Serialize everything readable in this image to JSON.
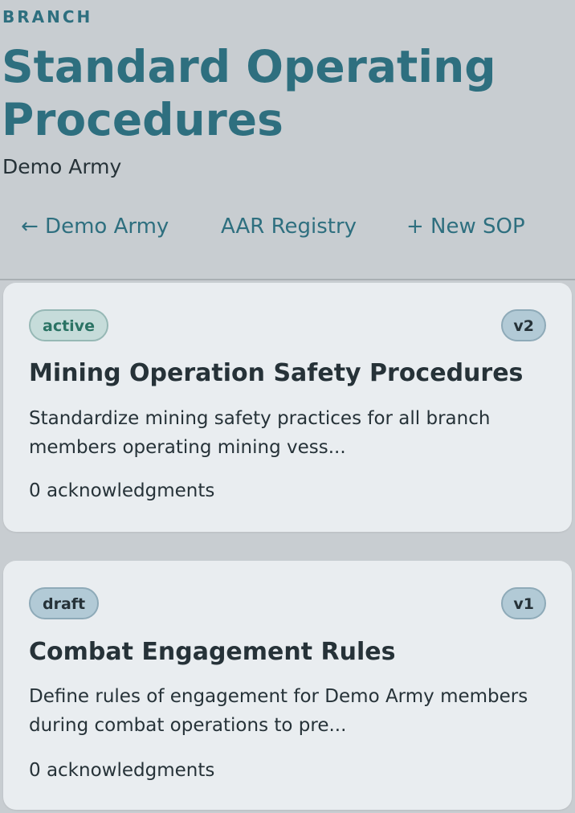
{
  "header": {
    "eyebrow": "BRANCH",
    "title": "Standard Operating Procedures",
    "subtitle": "Demo Army"
  },
  "nav": {
    "back_label": "← Demo Army",
    "aar_label": "AAR Registry",
    "new_sop_label": "+ New SOP"
  },
  "sops": [
    {
      "status": "active",
      "version": "v2",
      "title": "Mining Operation Safety Procedures",
      "description": "Standardize mining safety practices for all branch members operating mining vess...",
      "acknowledgments": "0 acknowledgments"
    },
    {
      "status": "draft",
      "version": "v1",
      "title": "Combat Engagement Rules",
      "description": "Define rules of engagement for Demo Army members during combat operations to pre...",
      "acknowledgments": "0 acknowledgments"
    }
  ],
  "colors": {
    "page_background": "#c8cdd1",
    "card_background": "#e9edf0",
    "accent": "#2e6f7f",
    "active_badge": "#c6dcda",
    "draft_badge": "#b2cad6"
  }
}
